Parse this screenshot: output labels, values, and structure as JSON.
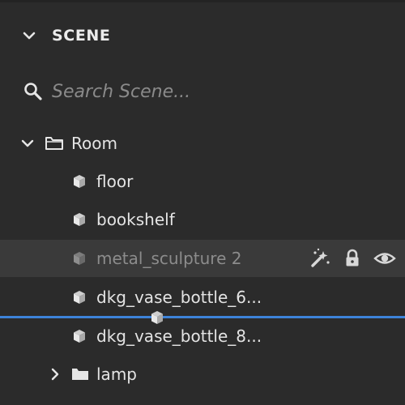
{
  "panel": {
    "title": "SCENE",
    "collapse_icon": "chevron-down-icon"
  },
  "search": {
    "placeholder": "Search Scene...",
    "value": "",
    "icon": "search-icon"
  },
  "tree": {
    "room": {
      "label": "Room",
      "icon": "folder-open-icon",
      "expanded": true
    },
    "items": [
      {
        "label": "floor",
        "icon": "cube-icon"
      },
      {
        "label": "bookshelf",
        "icon": "cube-icon"
      },
      {
        "label": "metal_sculpture 2",
        "icon": "cube-icon",
        "selected": true
      },
      {
        "label": "dkg_vase_bottle_6...",
        "icon": "cube-icon"
      },
      {
        "label": "dkg_vase_bottle_8...",
        "icon": "cube-icon"
      }
    ],
    "lamp": {
      "label": "lamp",
      "icon": "folder-icon",
      "expanded": false
    }
  },
  "row_actions": {
    "icons": [
      "magic-wand-icon",
      "lock-icon",
      "eye-icon"
    ]
  },
  "colors": {
    "background": "#2b2b2b",
    "selected_row": "#3a3a3a",
    "drop_indicator": "#3d83d9",
    "text": "#e4e4e4",
    "text_dimmed": "#8c8c8c"
  }
}
